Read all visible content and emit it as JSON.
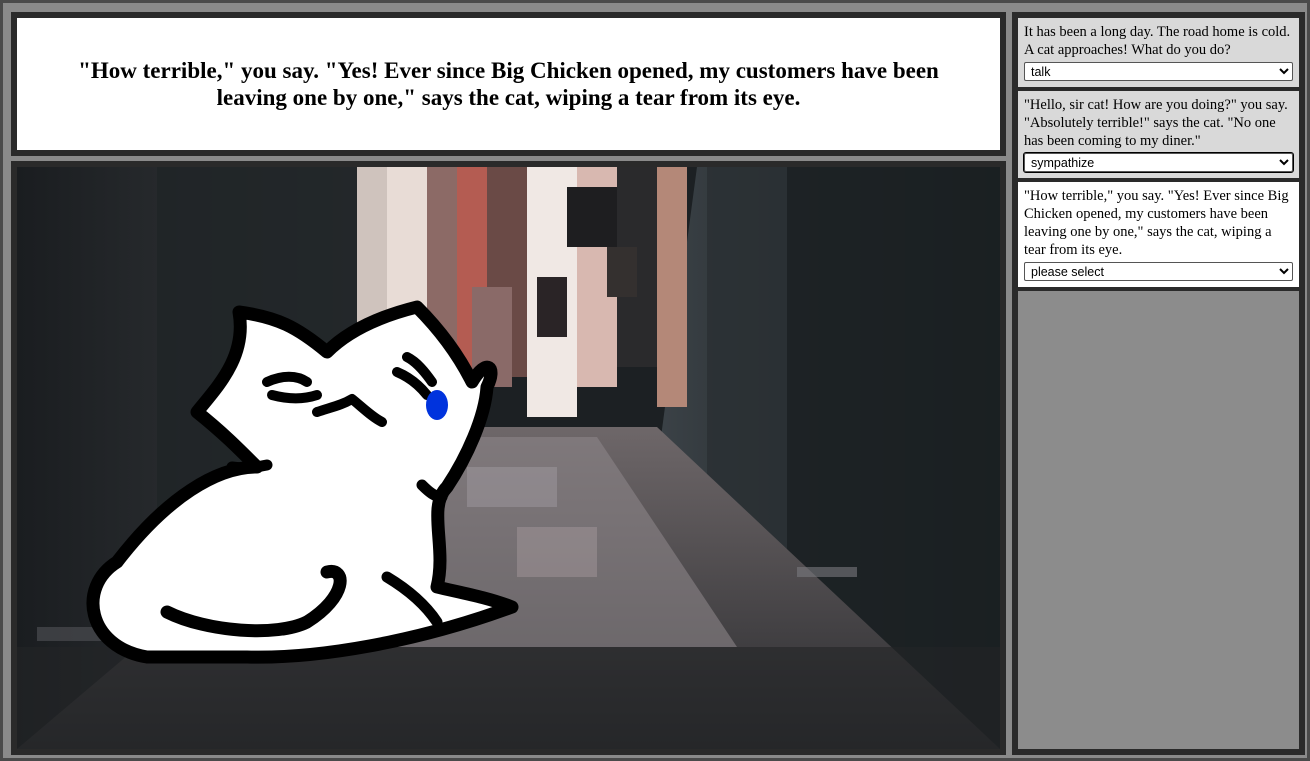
{
  "narration": "\"How terrible,\" you say. \"Yes! Ever since Big Chicken opened, my customers have been leaving one by one,\" says the cat, wiping a tear from its eye.",
  "scene": {
    "character": "crying-cat",
    "background": "dark-alley",
    "tear_color": "#0033dd"
  },
  "log": [
    {
      "text": "It has been a long day. The road home is cold. A cat approaches! What do you do?",
      "choice": "talk"
    },
    {
      "text": "\"Hello, sir cat! How are you doing?\" you say. \"Absolutely terrible!\" says the cat. \"No one has been coming to my diner.\"",
      "choice": "sympathize"
    },
    {
      "text": "\"How terrible,\" you say. \"Yes! Ever since Big Chicken opened, my customers have been leaving one by one,\" says the cat, wiping a tear from its eye.",
      "choice": "please select"
    }
  ]
}
